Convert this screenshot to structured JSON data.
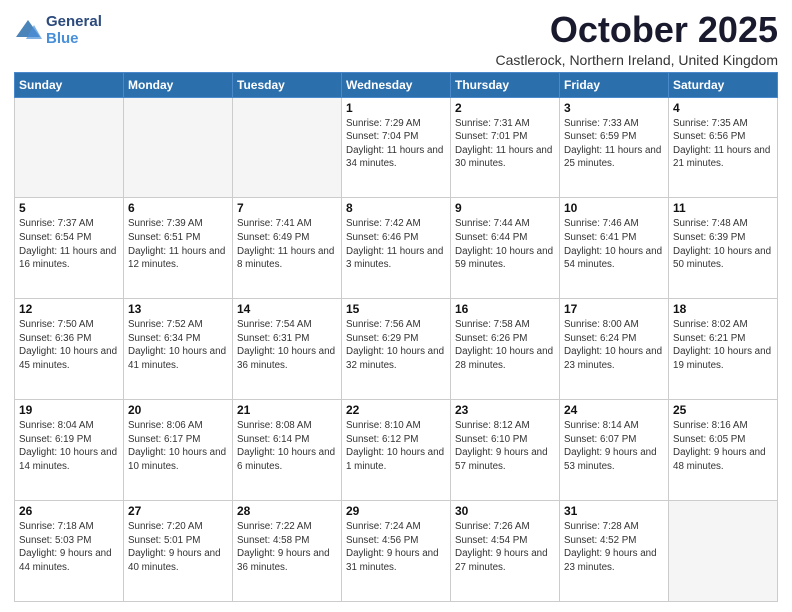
{
  "header": {
    "logo_general": "General",
    "logo_blue": "Blue",
    "month_title": "October 2025",
    "subtitle": "Castlerock, Northern Ireland, United Kingdom"
  },
  "days_of_week": [
    "Sunday",
    "Monday",
    "Tuesday",
    "Wednesday",
    "Thursday",
    "Friday",
    "Saturday"
  ],
  "weeks": [
    [
      {
        "num": "",
        "info": ""
      },
      {
        "num": "",
        "info": ""
      },
      {
        "num": "",
        "info": ""
      },
      {
        "num": "1",
        "info": "Sunrise: 7:29 AM\nSunset: 7:04 PM\nDaylight: 11 hours\nand 34 minutes."
      },
      {
        "num": "2",
        "info": "Sunrise: 7:31 AM\nSunset: 7:01 PM\nDaylight: 11 hours\nand 30 minutes."
      },
      {
        "num": "3",
        "info": "Sunrise: 7:33 AM\nSunset: 6:59 PM\nDaylight: 11 hours\nand 25 minutes."
      },
      {
        "num": "4",
        "info": "Sunrise: 7:35 AM\nSunset: 6:56 PM\nDaylight: 11 hours\nand 21 minutes."
      }
    ],
    [
      {
        "num": "5",
        "info": "Sunrise: 7:37 AM\nSunset: 6:54 PM\nDaylight: 11 hours\nand 16 minutes."
      },
      {
        "num": "6",
        "info": "Sunrise: 7:39 AM\nSunset: 6:51 PM\nDaylight: 11 hours\nand 12 minutes."
      },
      {
        "num": "7",
        "info": "Sunrise: 7:41 AM\nSunset: 6:49 PM\nDaylight: 11 hours\nand 8 minutes."
      },
      {
        "num": "8",
        "info": "Sunrise: 7:42 AM\nSunset: 6:46 PM\nDaylight: 11 hours\nand 3 minutes."
      },
      {
        "num": "9",
        "info": "Sunrise: 7:44 AM\nSunset: 6:44 PM\nDaylight: 10 hours\nand 59 minutes."
      },
      {
        "num": "10",
        "info": "Sunrise: 7:46 AM\nSunset: 6:41 PM\nDaylight: 10 hours\nand 54 minutes."
      },
      {
        "num": "11",
        "info": "Sunrise: 7:48 AM\nSunset: 6:39 PM\nDaylight: 10 hours\nand 50 minutes."
      }
    ],
    [
      {
        "num": "12",
        "info": "Sunrise: 7:50 AM\nSunset: 6:36 PM\nDaylight: 10 hours\nand 45 minutes."
      },
      {
        "num": "13",
        "info": "Sunrise: 7:52 AM\nSunset: 6:34 PM\nDaylight: 10 hours\nand 41 minutes."
      },
      {
        "num": "14",
        "info": "Sunrise: 7:54 AM\nSunset: 6:31 PM\nDaylight: 10 hours\nand 36 minutes."
      },
      {
        "num": "15",
        "info": "Sunrise: 7:56 AM\nSunset: 6:29 PM\nDaylight: 10 hours\nand 32 minutes."
      },
      {
        "num": "16",
        "info": "Sunrise: 7:58 AM\nSunset: 6:26 PM\nDaylight: 10 hours\nand 28 minutes."
      },
      {
        "num": "17",
        "info": "Sunrise: 8:00 AM\nSunset: 6:24 PM\nDaylight: 10 hours\nand 23 minutes."
      },
      {
        "num": "18",
        "info": "Sunrise: 8:02 AM\nSunset: 6:21 PM\nDaylight: 10 hours\nand 19 minutes."
      }
    ],
    [
      {
        "num": "19",
        "info": "Sunrise: 8:04 AM\nSunset: 6:19 PM\nDaylight: 10 hours\nand 14 minutes."
      },
      {
        "num": "20",
        "info": "Sunrise: 8:06 AM\nSunset: 6:17 PM\nDaylight: 10 hours\nand 10 minutes."
      },
      {
        "num": "21",
        "info": "Sunrise: 8:08 AM\nSunset: 6:14 PM\nDaylight: 10 hours\nand 6 minutes."
      },
      {
        "num": "22",
        "info": "Sunrise: 8:10 AM\nSunset: 6:12 PM\nDaylight: 10 hours\nand 1 minute."
      },
      {
        "num": "23",
        "info": "Sunrise: 8:12 AM\nSunset: 6:10 PM\nDaylight: 9 hours\nand 57 minutes."
      },
      {
        "num": "24",
        "info": "Sunrise: 8:14 AM\nSunset: 6:07 PM\nDaylight: 9 hours\nand 53 minutes."
      },
      {
        "num": "25",
        "info": "Sunrise: 8:16 AM\nSunset: 6:05 PM\nDaylight: 9 hours\nand 48 minutes."
      }
    ],
    [
      {
        "num": "26",
        "info": "Sunrise: 7:18 AM\nSunset: 5:03 PM\nDaylight: 9 hours\nand 44 minutes."
      },
      {
        "num": "27",
        "info": "Sunrise: 7:20 AM\nSunset: 5:01 PM\nDaylight: 9 hours\nand 40 minutes."
      },
      {
        "num": "28",
        "info": "Sunrise: 7:22 AM\nSunset: 4:58 PM\nDaylight: 9 hours\nand 36 minutes."
      },
      {
        "num": "29",
        "info": "Sunrise: 7:24 AM\nSunset: 4:56 PM\nDaylight: 9 hours\nand 31 minutes."
      },
      {
        "num": "30",
        "info": "Sunrise: 7:26 AM\nSunset: 4:54 PM\nDaylight: 9 hours\nand 27 minutes."
      },
      {
        "num": "31",
        "info": "Sunrise: 7:28 AM\nSunset: 4:52 PM\nDaylight: 9 hours\nand 23 minutes."
      },
      {
        "num": "",
        "info": ""
      }
    ]
  ]
}
